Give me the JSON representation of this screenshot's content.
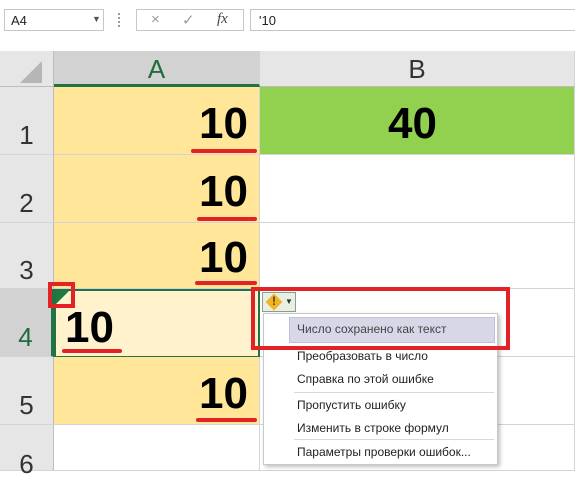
{
  "formula_bar": {
    "name_box": "A4",
    "cancel_icon": "×",
    "enter_icon": "✓",
    "fx_label": "fx",
    "formula": "'10"
  },
  "columns": [
    "A",
    "B"
  ],
  "rows": [
    "1",
    "2",
    "3",
    "4",
    "5",
    "6"
  ],
  "cells": {
    "A1": "10",
    "B1": "40",
    "A2": "10",
    "A3": "10",
    "A4": "10",
    "A5": "10"
  },
  "smart_tag": {
    "symbol": "!"
  },
  "context_menu": {
    "items": [
      "Число сохранено как текст",
      "Преобразовать в число",
      "Справка по этой ошибке",
      "Пропустить ошибку",
      "Изменить в строке формул",
      "Параметры проверки ошибок..."
    ]
  },
  "colors": {
    "number_cell_fill": "#ffe699",
    "selected_cell_fill": "#fff2cc",
    "sum_cell_fill": "#92d050",
    "highlight_red": "#e32227",
    "excel_green": "#217346"
  }
}
